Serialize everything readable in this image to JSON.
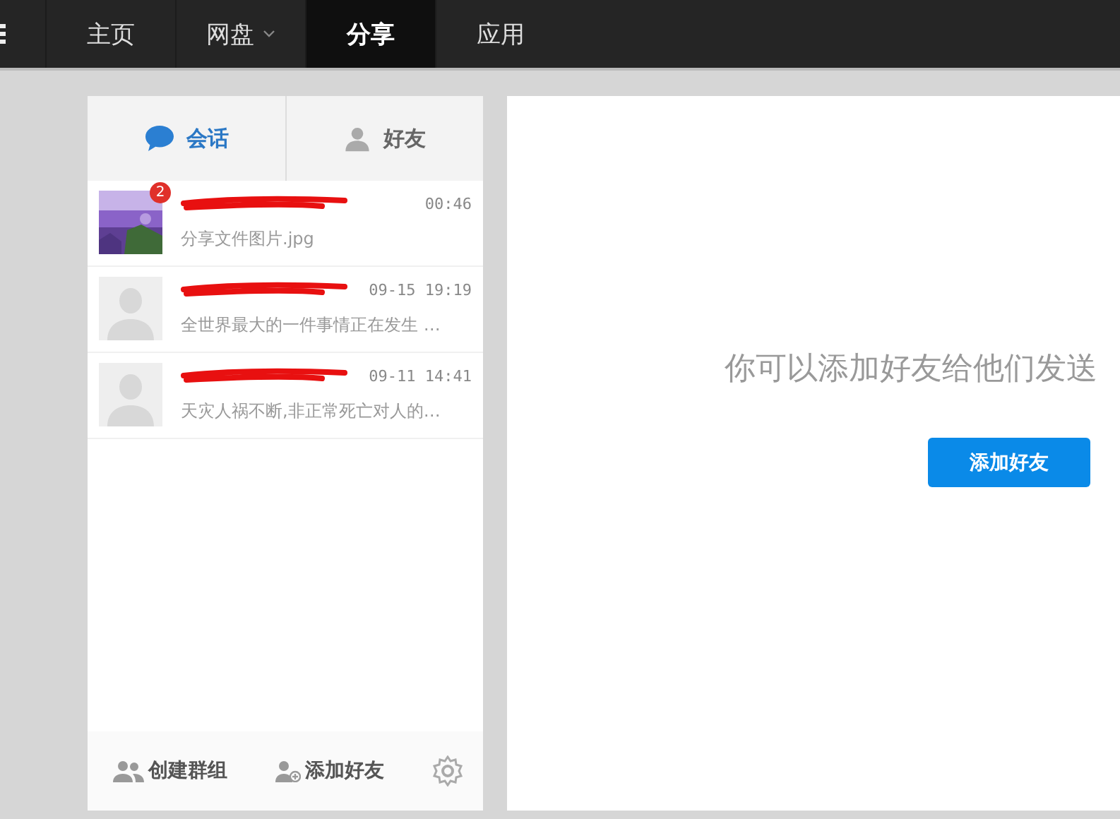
{
  "nav": [
    {
      "label": "主页",
      "selected": false,
      "dropdown": false
    },
    {
      "label": "网盘",
      "selected": false,
      "dropdown": true
    },
    {
      "label": "分享",
      "selected": true,
      "dropdown": false
    },
    {
      "label": "应用",
      "selected": false,
      "dropdown": false
    }
  ],
  "tabs": [
    {
      "label": "会话",
      "kind": "chat",
      "selected": true
    },
    {
      "label": "好友",
      "kind": "friend",
      "selected": false
    }
  ],
  "conversations": [
    {
      "kind": "picture",
      "unread": "2",
      "time": "00:46",
      "preview": "分享文件图片.jpg"
    },
    {
      "kind": "default",
      "time": "09-15 19:19",
      "preview": "全世界最大的一件事情正在发生 …"
    },
    {
      "kind": "default",
      "time": "09-11 14:41",
      "preview": "天灾人祸不断,非正常死亡对人的…"
    }
  ],
  "empty_message": "你可以添加好友给他们发送",
  "add_button": "添加好友",
  "footer": [
    {
      "label": "创建群组",
      "kind": "group"
    },
    {
      "label": "添加好友",
      "kind": "add"
    },
    {
      "kind": "settings"
    }
  ]
}
